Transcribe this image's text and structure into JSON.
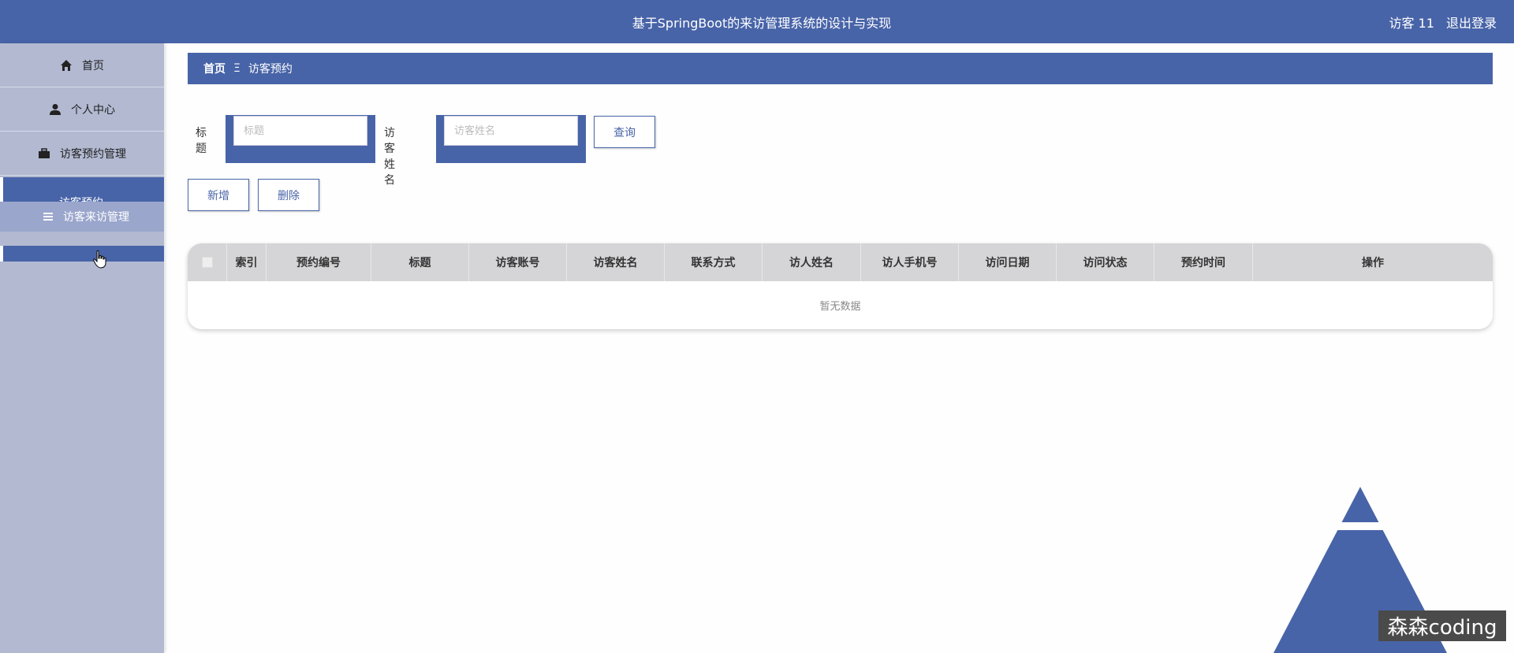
{
  "header": {
    "title": "基于SpringBoot的来访管理系统的设计与实现",
    "user": "访客 11",
    "logout": "退出登录"
  },
  "sidebar": {
    "items": [
      {
        "label": "首页",
        "icon": "home-icon"
      },
      {
        "label": "个人中心",
        "icon": "user-icon"
      },
      {
        "label": "访客预约管理",
        "icon": "briefcase-icon"
      }
    ],
    "sub": {
      "active": "访客预约",
      "hover": "访客来访管理",
      "icon": "list-icon"
    }
  },
  "breadcrumb": {
    "home": "首页",
    "sep": "Ξ",
    "current": "访客预约"
  },
  "search": {
    "title_label": "标题",
    "title_placeholder": "标题",
    "name_label": "访客姓名",
    "name_placeholder": "访客姓名",
    "query_btn": "查询"
  },
  "actions": {
    "add": "新增",
    "delete": "删除"
  },
  "table": {
    "columns": [
      "索引",
      "预约编号",
      "标题",
      "访客账号",
      "访客姓名",
      "联系方式",
      "访人姓名",
      "访人手机号",
      "访问日期",
      "访问状态",
      "预约时间",
      "操作"
    ],
    "empty": "暂无数据"
  },
  "watermark": "森森coding",
  "colors": {
    "primary": "#4864a8",
    "sidebar": "#b2b9d1"
  }
}
